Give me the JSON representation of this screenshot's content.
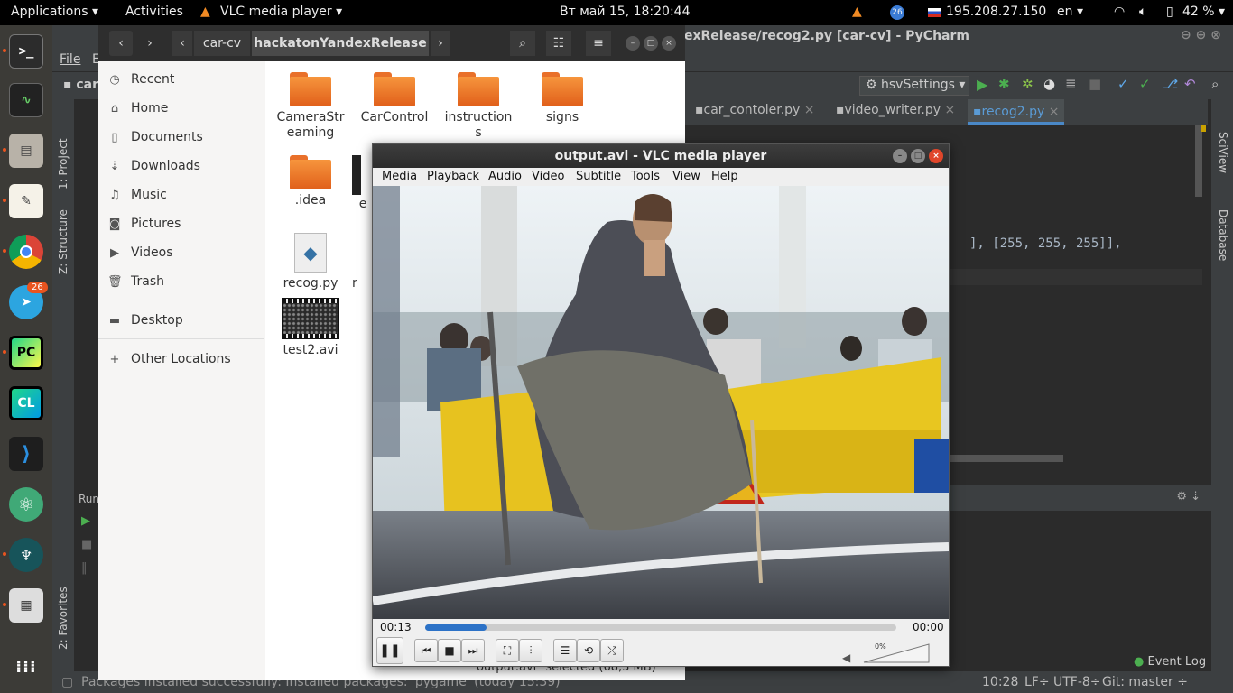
{
  "topbar": {
    "applications": "Applications",
    "activities": "Activities",
    "app_name": "VLC media player",
    "datetime": "Вт май 15, 18:20:44",
    "telegram_badge": "26",
    "ip": "195.208.27.150",
    "lang": "en",
    "battery": "42 %"
  },
  "dock": {
    "telegram_badge": "26",
    "icons": [
      "terminal-icon",
      "system-monitor-icon",
      "files-icon",
      "text-editor-icon",
      "chrome-icon",
      "telegram-icon",
      "pycharm-icon",
      "clion-icon",
      "vscode-icon",
      "atom-icon",
      "gitkraken-icon",
      "calculator-icon",
      "app-grid-icon"
    ]
  },
  "pycharm": {
    "title": "exRelease/recog2.py [car-cv] - PyCharm",
    "menu_file": "File",
    "menu_edit": "E",
    "project_crumb": "car",
    "run_config": "hsvSettings",
    "tabs": [
      "car_contoler.py",
      "video_writer.py",
      "recog2.py"
    ],
    "code_line": "], [255, 255, 255]],",
    "left_tools": [
      "1: Project",
      "Z: Structure",
      "2: Favorites"
    ],
    "right_tools": [
      "SciView",
      "Database"
    ],
    "run_label": "Run",
    "event_log": "Event Log",
    "status_message": "Packages installed successfully: Installed packages: 'pygame' (today 15:39)",
    "cursor_pos": "10:28",
    "line_sep": "LF÷",
    "encoding": "UTF-8÷",
    "git": "Git: master ÷"
  },
  "files": {
    "crumbs": [
      "car-cv",
      "hackatonYandexRelease"
    ],
    "sidebar": [
      {
        "label": "Recent",
        "icon": "clock-icon"
      },
      {
        "label": "Home",
        "icon": "home-icon"
      },
      {
        "label": "Documents",
        "icon": "document-icon"
      },
      {
        "label": "Downloads",
        "icon": "download-icon"
      },
      {
        "label": "Music",
        "icon": "music-icon"
      },
      {
        "label": "Pictures",
        "icon": "camera-icon"
      },
      {
        "label": "Videos",
        "icon": "video-icon"
      },
      {
        "label": "Trash",
        "icon": "trash-icon"
      },
      {
        "label": "Desktop",
        "icon": "folder-icon"
      },
      {
        "label": "Other Locations",
        "icon": "plus-icon"
      }
    ],
    "items": [
      {
        "name": "CameraStr\neaming",
        "type": "folder"
      },
      {
        "name": "CarControl",
        "type": "folder"
      },
      {
        "name": "instruction\ns",
        "type": "folder"
      },
      {
        "name": "signs",
        "type": "folder"
      },
      {
        "name": ".idea",
        "type": "folder"
      },
      {
        "name": "e",
        "type": "file"
      },
      {
        "name": "recog.py",
        "type": "python"
      },
      {
        "name": "r",
        "type": "file"
      },
      {
        "name": "test2.avi",
        "type": "video"
      }
    ],
    "status": "\"output.avi\" selected  (68,3 MB)"
  },
  "vlc": {
    "title": "output.avi - VLC media player",
    "menu": [
      "Media",
      "Playback",
      "Audio",
      "Video",
      "Subtitle",
      "Tools",
      "View",
      "Help"
    ],
    "time_elapsed": "00:13",
    "time_total": "00:00",
    "progress_fraction": 0.13,
    "volume_label": "0%"
  }
}
